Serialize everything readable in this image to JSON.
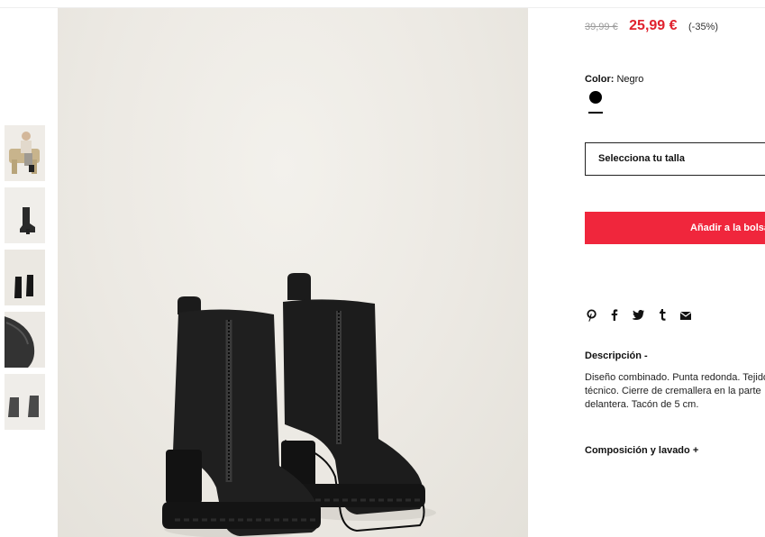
{
  "product": {
    "price_original": "39,99 €",
    "price_sale": "25,99 €",
    "discount": "(-35%)",
    "color_label": "Color:",
    "color_value": "Negro",
    "swatch_color": "#000000",
    "size_placeholder": "Selecciona tu talla",
    "add_to_bag": "Añadir a la bolsa",
    "description_title": "Descripción",
    "description_toggle": "-",
    "description_text": "Diseño combinado. Punta redonda. Tejido técnico. Cierre de cremallera en la parte delantera. Tacón de 5 cm.",
    "composition_title": "Composición y lavado",
    "composition_toggle": "+"
  },
  "share": {
    "pinterest": "P",
    "facebook": "f",
    "twitter": "t-bird",
    "tumblr": "t",
    "email": "✉"
  },
  "thumbnails": [
    {
      "icon": "model-seated-photo"
    },
    {
      "icon": "single-boot-side-photo"
    },
    {
      "icon": "boot-pair-front-photo"
    },
    {
      "icon": "boot-sole-detail-photo"
    },
    {
      "icon": "boot-pair-back-photo"
    }
  ],
  "colors": {
    "sale_red": "#e0222e",
    "button_red": "#f0263c",
    "image_background": "#ece9e3"
  }
}
